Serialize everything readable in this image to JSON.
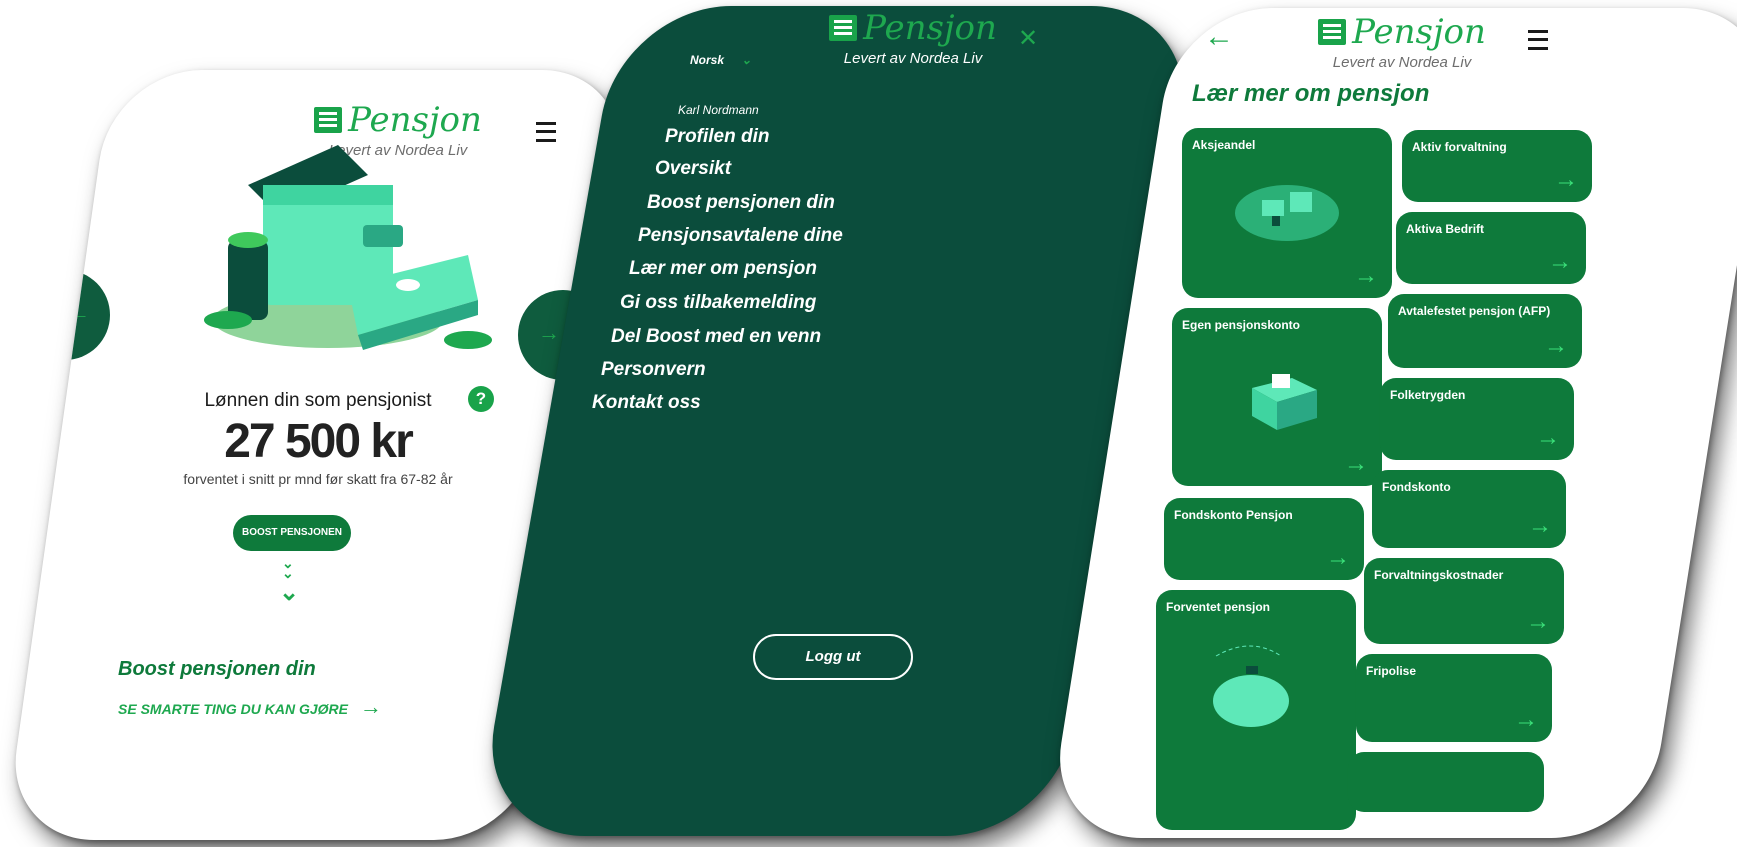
{
  "colors": {
    "brand_green": "#1ea84f",
    "dark_green": "#0b4d3c",
    "card_green": "#0e7a3b",
    "mint": "#5ee8b8"
  },
  "phone1": {
    "logo_text": "Pensjon",
    "logo_subtitle": "Levert av Nordea Liv",
    "menu_icon": "hamburger-icon",
    "salary_title": "Lønnen din som pensjonist",
    "salary_amount": "27 500 kr",
    "salary_caption": "forventet i snitt pr mnd før skatt fra 67-82 år",
    "help_label": "?",
    "boost_button_label": "BOOST PENSJONEN DIN",
    "section_title": "Boost pensjonen din",
    "section_link": "SE SMARTE TING DU KAN GJØRE",
    "arrow_glyph": "→",
    "prev_glyph": "←",
    "next_glyph": "→"
  },
  "phone2": {
    "logo_text": "Pensjon",
    "logo_subtitle": "Levert av Nordea Liv",
    "language": "Norsk",
    "close_glyph": "✕",
    "user_name": "Karl Nordmann",
    "menu_items": [
      "Profilen din",
      "Oversikt",
      "Boost pensjonen din",
      "Pensjonsavtalene dine",
      "Lær mer om pensjon",
      "Gi oss tilbakemelding",
      "Del Boost med en venn",
      "Personvern",
      "Kontakt oss"
    ],
    "logout_label": "Logg ut"
  },
  "phone3": {
    "logo_text": "Pensjon",
    "logo_subtitle": "Levert av Nordea Liv",
    "back_glyph": "←",
    "page_title": "Lær mer om pensjon",
    "cards": [
      "Aksjeandel",
      "Aktiv forvaltning",
      "Aktiva Bedrift",
      "Egen pensjonskonto",
      "Avtalefestet pensjon (AFP)",
      "Folketrygden",
      "Fondskonto",
      "Fondskonto Pensjon",
      "Forvaltningskostnader",
      "Forventet pensjon",
      "Fripolise"
    ],
    "card_arrow": "→"
  }
}
